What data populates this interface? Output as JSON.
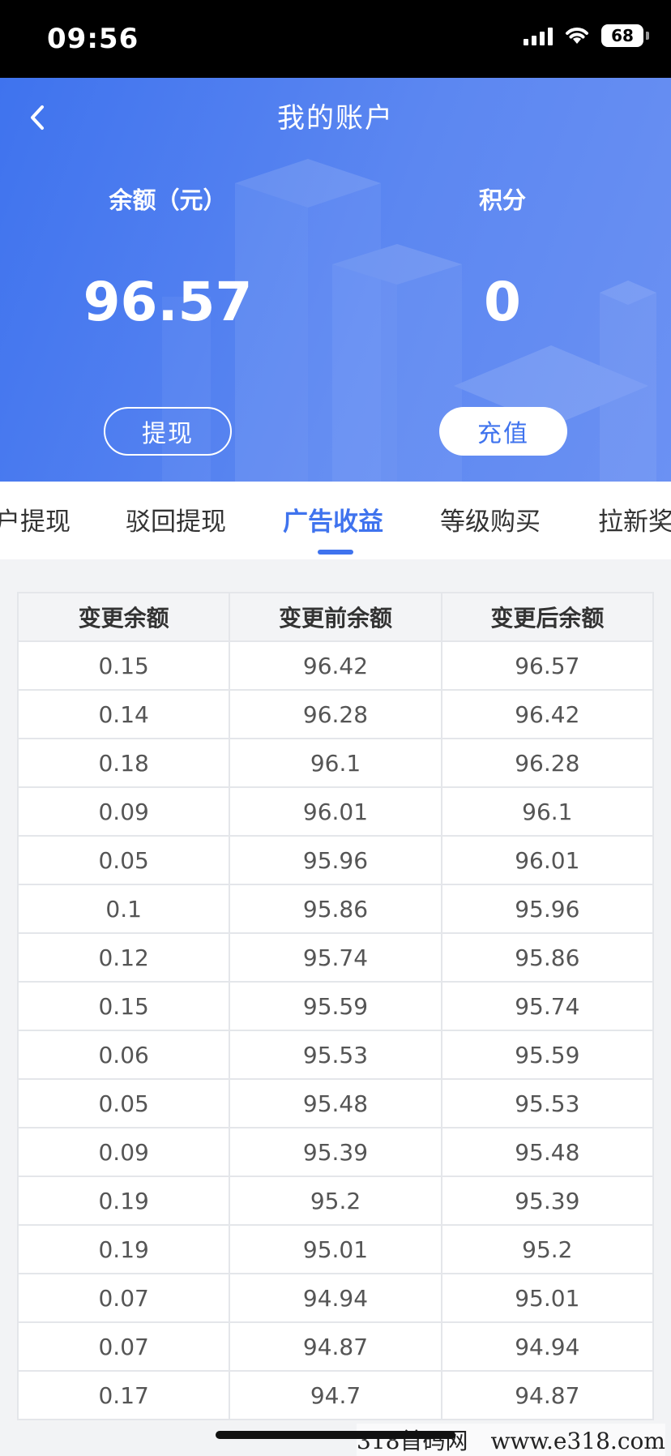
{
  "status_bar": {
    "time": "09:56",
    "battery": "68"
  },
  "header": {
    "title": "我的账户",
    "balance_label": "余额（元）",
    "balance_value": "96.57",
    "points_label": "积分",
    "points_value": "0",
    "withdraw_button": "提现",
    "recharge_button": "充值",
    "accent_color": "#3f73ee"
  },
  "tabs": [
    {
      "label": "户提现"
    },
    {
      "label": "驳回提现"
    },
    {
      "label": "广告收益",
      "active": true
    },
    {
      "label": "等级购买"
    },
    {
      "label": "拉新奖"
    }
  ],
  "table": {
    "headers": [
      "变更余额",
      "变更前余额",
      "变更后余额"
    ],
    "rows": [
      [
        "0.15",
        "96.42",
        "96.57"
      ],
      [
        "0.14",
        "96.28",
        "96.42"
      ],
      [
        "0.18",
        "96.1",
        "96.28"
      ],
      [
        "0.09",
        "96.01",
        "96.1"
      ],
      [
        "0.05",
        "95.96",
        "96.01"
      ],
      [
        "0.1",
        "95.86",
        "95.96"
      ],
      [
        "0.12",
        "95.74",
        "95.86"
      ],
      [
        "0.15",
        "95.59",
        "95.74"
      ],
      [
        "0.06",
        "95.53",
        "95.59"
      ],
      [
        "0.05",
        "95.48",
        "95.53"
      ],
      [
        "0.09",
        "95.39",
        "95.48"
      ],
      [
        "0.19",
        "95.2",
        "95.39"
      ],
      [
        "0.19",
        "95.01",
        "95.2"
      ],
      [
        "0.07",
        "94.94",
        "95.01"
      ],
      [
        "0.07",
        "94.87",
        "94.94"
      ],
      [
        "0.17",
        "94.7",
        "94.87"
      ]
    ]
  },
  "watermark": "318首码网　www.e318.com"
}
